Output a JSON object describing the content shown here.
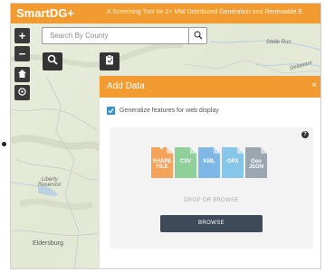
{
  "header": {
    "app_name": "SmartDG+",
    "subtitle": "A Screening Tool for 2+ MW Distributed Generation and Renewable E"
  },
  "search": {
    "placeholder": "Search By County"
  },
  "toolbar": {
    "zoom_in_label": "+",
    "zoom_out_label": "−"
  },
  "map": {
    "labels": {
      "stelle_run": "Stelle Run",
      "delaware_river": "Delaware",
      "liberty_reservoir": "Liberty\nReservoir",
      "eldersburg": "Eldersburg"
    }
  },
  "panel": {
    "title": "Add Data",
    "close_label": "×",
    "generalize_label": "Generalize features for web display",
    "generalize_checked": true,
    "file_types": [
      {
        "label": "SHAPE FILE",
        "color": "#f5a35a"
      },
      {
        "label": "CSV",
        "color": "#8fcf9a"
      },
      {
        "label": "KML",
        "color": "#7fb8e6"
      },
      {
        "label": "GPX",
        "color": "#86c6e8"
      },
      {
        "label": "Geo JSON",
        "color": "#9aa6b0"
      }
    ],
    "drop_text": "DROP OR BROWSE",
    "browse_label": "BROWSE"
  },
  "colors": {
    "accent": "#f29b30",
    "checkbox": "#3d8fc9",
    "browse_button": "#3d4a5a"
  }
}
